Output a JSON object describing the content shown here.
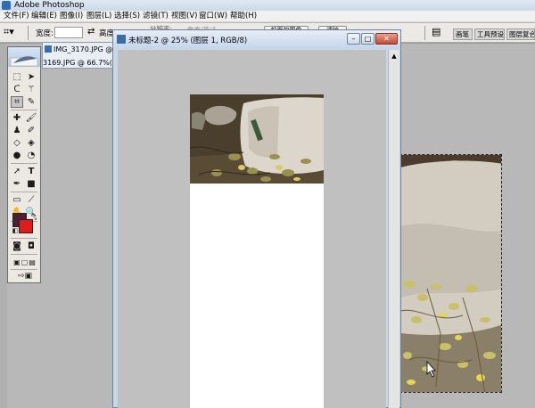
{
  "app": {
    "title": "Adobe Photoshop"
  },
  "menu": [
    "文件(F)",
    "编辑(E)",
    "图像(I)",
    "图层(L)",
    "选择(S)",
    "滤镜(T)",
    "视图(V)",
    "窗口(W)",
    "帮助(H)"
  ],
  "options": {
    "width_label": "宽度:",
    "height_label": "高度",
    "resolution_label": "分辨率:",
    "unit_label": "像素/英寸",
    "front_image_button": "前面的图像",
    "clear_button": "清除"
  },
  "palette_tabs": [
    "画笔",
    "工具预设",
    "图层复合"
  ],
  "documents": {
    "doc1_title": "IMG_3170.JPG @",
    "doc2_title": "3169.JPG @ 66.7%(RG",
    "active_title": "未标题-2 @ 25% (图层 1, RGB/8)"
  },
  "colors": {
    "foreground": "#4c1f37",
    "background": "#e01b1b"
  },
  "icons": {
    "crop": "crop-icon",
    "marquee": "marquee-icon",
    "move": "move-icon",
    "lasso": "lasso-icon",
    "magic_wand": "magic-wand-icon",
    "slice": "slice-icon",
    "healing": "healing-brush-icon",
    "brush": "brush-icon",
    "stamp": "clone-stamp-icon",
    "history_brush": "history-brush-icon",
    "eraser": "eraser-icon",
    "bucket": "paint-bucket-icon",
    "blur": "blur-icon",
    "dodge": "dodge-icon",
    "path_select": "path-selection-icon",
    "type": "type-icon",
    "pen": "pen-icon",
    "shape": "shape-icon",
    "notes": "notes-icon",
    "eyedropper": "eyedropper-icon",
    "hand": "hand-icon",
    "zoom": "zoom-icon"
  }
}
